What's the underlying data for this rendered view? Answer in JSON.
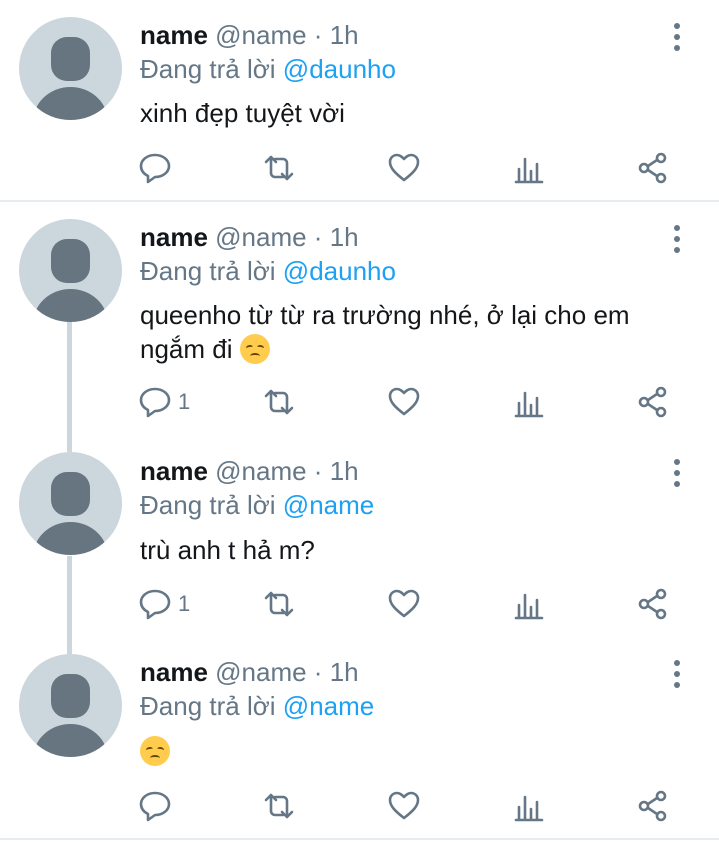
{
  "tweets": [
    {
      "name": "name",
      "meta": "@name · 1h",
      "reply_prefix": "Đang trả lời",
      "reply_to": "@daunho",
      "text": "xinh đẹp tuyệt vời",
      "has_emoji": false,
      "reply_count": ""
    },
    {
      "name": "name",
      "meta": "@name · 1h",
      "reply_prefix": "Đang trả lời",
      "reply_to": "@daunho",
      "text": "queenho từ từ ra trường nhé, ở lại cho em ngắm đi",
      "has_emoji": true,
      "reply_count": "1"
    },
    {
      "name": "name",
      "meta": "@name · 1h",
      "reply_prefix": "Đang trả lời",
      "reply_to": "@name",
      "text": "trù anh t hả m?",
      "has_emoji": false,
      "reply_count": "1"
    },
    {
      "name": "name",
      "meta": "@name · 1h",
      "reply_prefix": "Đang trả lời",
      "reply_to": "@name",
      "text": "",
      "has_emoji": true,
      "reply_count": ""
    }
  ],
  "icons": {
    "reply": "reply-icon",
    "retweet": "retweet-icon",
    "like": "heart-icon",
    "analytics": "analytics-icon",
    "share": "share-icon",
    "more": "more-vertical-icon"
  },
  "colors": {
    "text_primary": "#14171a",
    "text_secondary": "#657786",
    "mention": "#1da1f2",
    "avatar_bg": "#ccd6dd",
    "separator": "#e6ecf0"
  }
}
